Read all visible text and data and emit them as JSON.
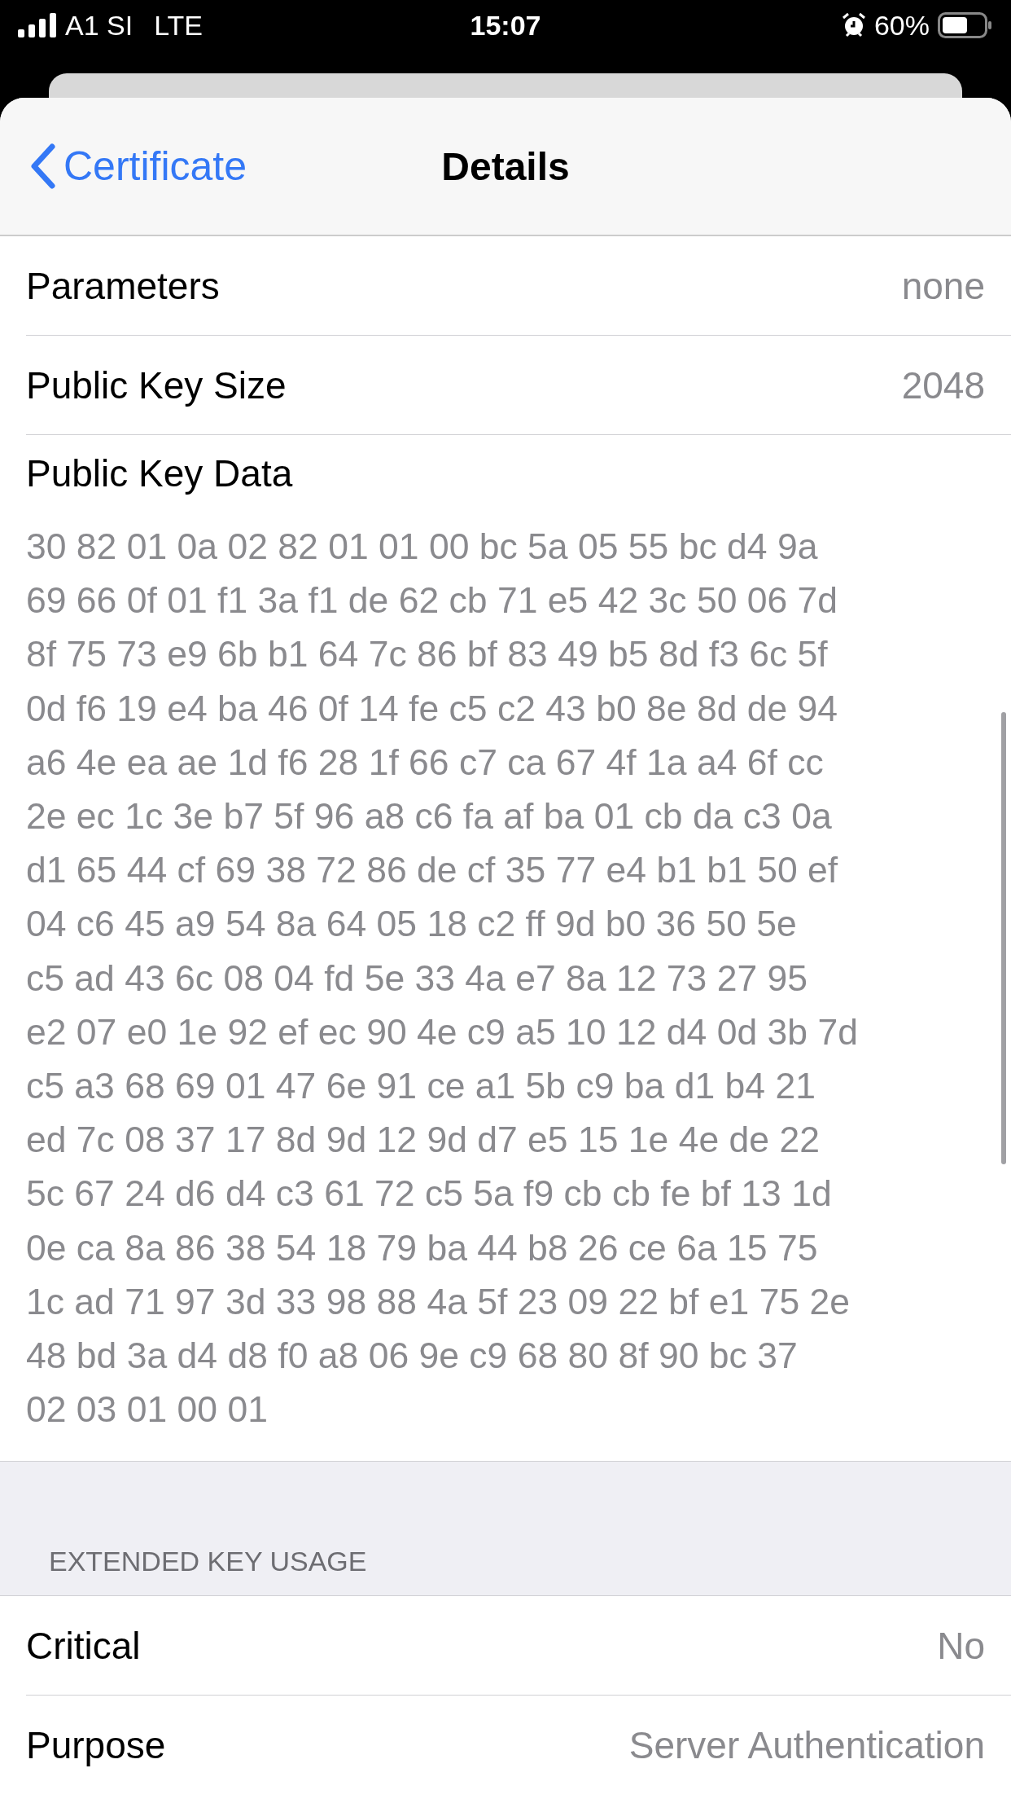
{
  "status_bar": {
    "carrier": "A1 SI",
    "network": "LTE",
    "time": "15:07",
    "battery": "60%"
  },
  "nav": {
    "back": "Certificate",
    "title": "Details"
  },
  "rows": [
    {
      "label": "Parameters",
      "value": "none"
    },
    {
      "label": "Public Key Size",
      "value": "2048"
    }
  ],
  "key_data": {
    "label": "Public Key Data",
    "lines": [
      "30 82 01 0a 02 82 01 01 00 bc 5a 05 55 bc d4 9a",
      "69 66 0f 01 f1 3a f1 de 62 cb 71 e5 42 3c 50 06 7d",
      "8f 75 73 e9 6b b1 64 7c 86 bf 83 49 b5 8d f3 6c 5f",
      "0d f6 19 e4 ba 46 0f 14 fe c5 c2 43 b0 8e 8d de 94",
      "a6 4e ea ae 1d f6 28 1f 66 c7 ca 67 4f 1a a4 6f cc",
      "2e ec 1c 3e b7 5f 96 a8 c6 fa af ba 01 cb da c3 0a",
      "d1 65 44 cf 69 38 72 86 de cf 35 77 e4 b1 b1 50 ef",
      "04 c6 45 a9 54 8a 64 05 18 c2 ff 9d b0 36 50 5e",
      "c5 ad 43 6c 08 04 fd 5e 33 4a e7 8a 12 73 27 95",
      "e2 07 e0 1e 92 ef ec 90 4e c9 a5 10 12 d4 0d 3b 7d",
      "c5 a3 68 69 01 47 6e 91 ce a1 5b c9 ba d1 b4 21",
      "ed 7c 08 37 17 8d 9d 12 9d d7 e5 15 1e 4e de 22",
      "5c 67 24 d6 d4 c3 61 72 c5 5a f9 cb cb fe bf 13 1d",
      "0e ca 8a 86 38 54 18 79 ba 44 b8 26 ce 6a 15 75",
      "1c ad 71 97 3d 33 98 88 4a 5f 23 09 22 bf e1 75 2e",
      "48 bd 3a d4 d8 f0 a8 06 9e c9 68 80 8f 90 bc 37",
      "02 03 01 00 01"
    ]
  },
  "section": {
    "header": "EXTENDED KEY USAGE",
    "rows": [
      {
        "label": "Critical",
        "value": "No"
      },
      {
        "label": "Purpose",
        "value": "Server Authentication"
      }
    ]
  }
}
